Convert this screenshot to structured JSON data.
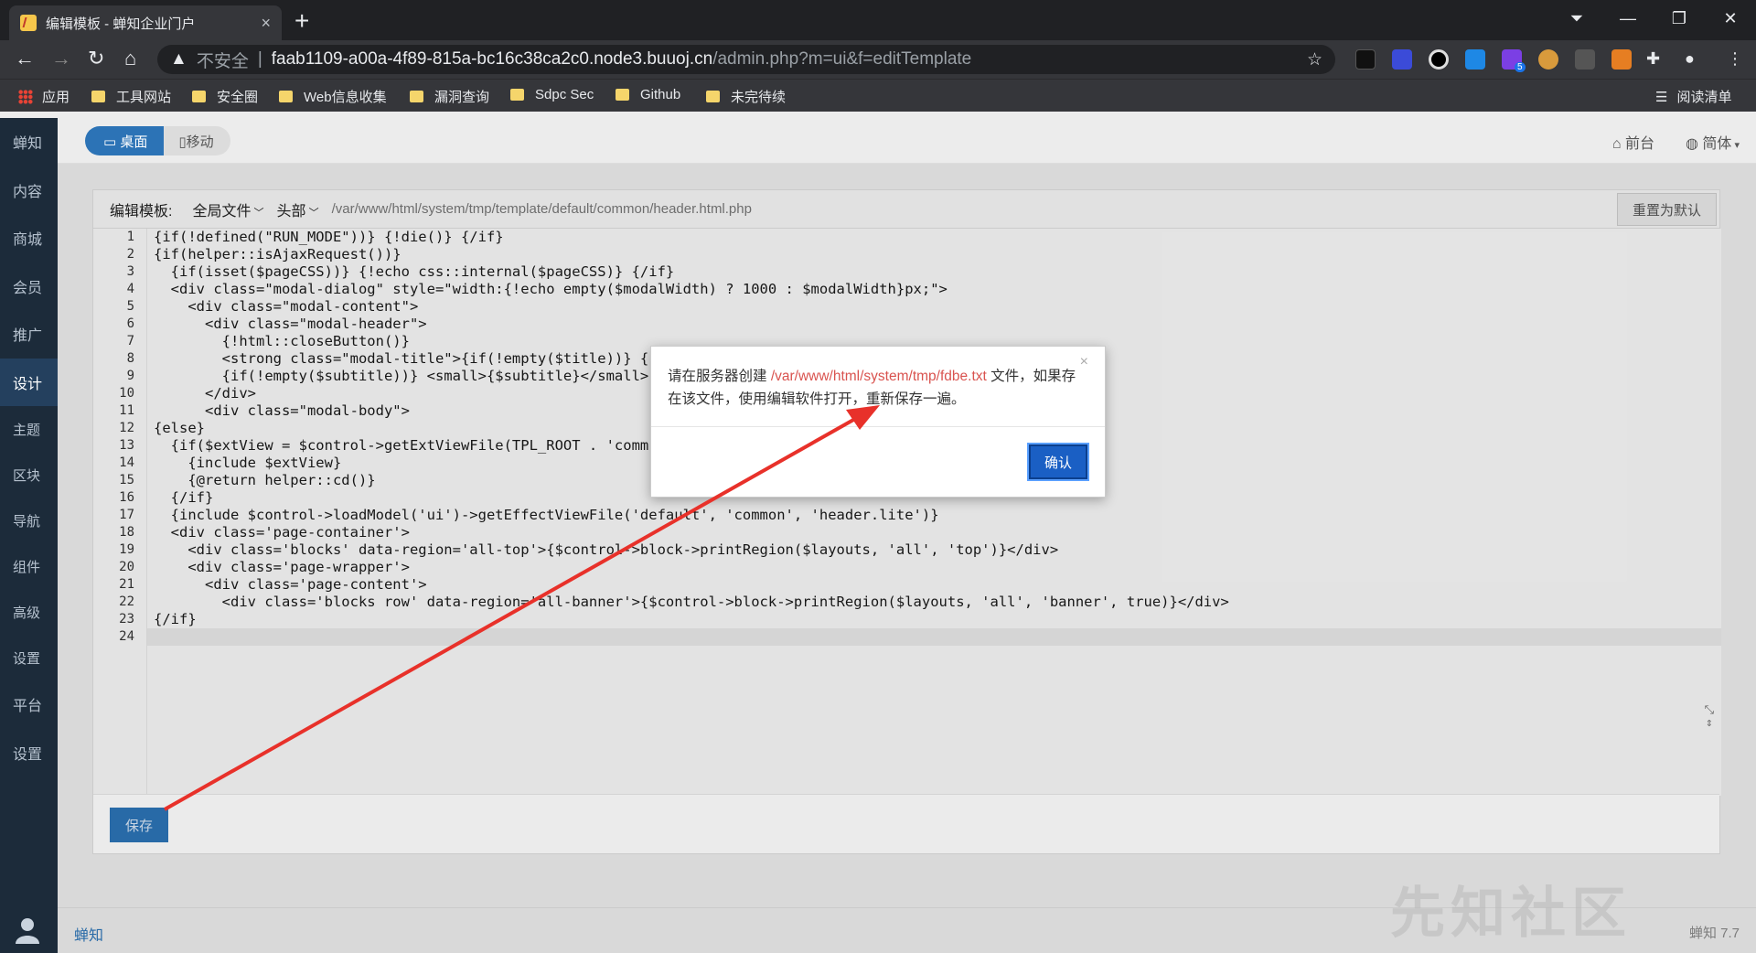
{
  "browser": {
    "tab_title": "编辑模板 - 蝉知企业门户",
    "tab_close": "×",
    "new_tab": "+",
    "insecure_label": "不安全",
    "url_host": "faab1109-a00a-4f89-815a-bc16c38ca2c0.node3.buuoj.cn",
    "url_path": "/admin.php?m=ui&f=editTemplate",
    "extension_badge": "5",
    "bookmarks": [
      "应用",
      "工具网站",
      "安全圈",
      "Web信息收集",
      "漏洞查询",
      "Sdpc Sec",
      "Github",
      "未完待续"
    ],
    "reading_list": "阅读清单"
  },
  "sidebar": {
    "items": [
      "蝉知",
      "内容",
      "商城",
      "会员",
      "推广",
      "设计",
      "主题",
      "区块",
      "导航",
      "组件",
      "高级",
      "设置",
      "平台",
      "设置"
    ],
    "active_index": 5
  },
  "topbar": {
    "desktop": "桌面",
    "mobile": "移动",
    "front": "前台",
    "lang": "简体"
  },
  "panel": {
    "label": "编辑模板:",
    "dropdown1": "全局文件",
    "dropdown2": "头部",
    "path": "/var/www/html/system/tmp/template/default/common/header.html.php",
    "reset": "重置为默认",
    "save": "保存"
  },
  "code_lines": [
    "{if(!defined(\"RUN_MODE\"))} {!die()} {/if}",
    "{if(helper::isAjaxRequest())}",
    "  {if(isset($pageCSS))} {!echo css::internal($pageCSS)} {/if}",
    "  <div class=\"modal-dialog\" style=\"width:{!echo empty($modalWidth) ? 1000 : $modalWidth}px;\">",
    "    <div class=\"modal-content\">",
    "      <div class=\"modal-header\">",
    "        {!html::closeButton()}",
    "        <strong class=\"modal-title\">{if(!empty($title))} {",
    "        {if(!empty($subtitle))} <small>{$subtitle}</small>",
    "      </div>",
    "      <div class=\"modal-body\">",
    "{else}",
    "  {if($extView = $control->getExtViewFile(TPL_ROOT . 'comm",
    "    {include $extView}",
    "    {@return helper::cd()}",
    "  {/if}",
    "  {include $control->loadModel('ui')->getEffectViewFile('default', 'common', 'header.lite')}",
    "  <div class='page-container'>",
    "    <div class='blocks' data-region='all-top'>{$control->block->printRegion($layouts, 'all', 'top')}</div>",
    "    <div class='page-wrapper'>",
    "      <div class='page-content'>",
    "        <div class='blocks row' data-region='all-banner'>{$control->block->printRegion($layouts, 'all', 'banner', true)}</div>",
    "{/if}",
    ""
  ],
  "modal": {
    "text_before": "请在服务器创建 ",
    "file": "/var/www/html/system/tmp/fdbe.txt",
    "text_after": " 文件，如果存在该文件，使用编辑软件打开，重新保存一遍。",
    "close": "×",
    "ok": "确认"
  },
  "footer": {
    "left": "蝉知",
    "right": "蝉知 7.7"
  },
  "watermark": "先知社区",
  "colors": {
    "accent": "#2c73b6",
    "sidebar": "#1c2b3a",
    "arrow": "#e8312a"
  }
}
